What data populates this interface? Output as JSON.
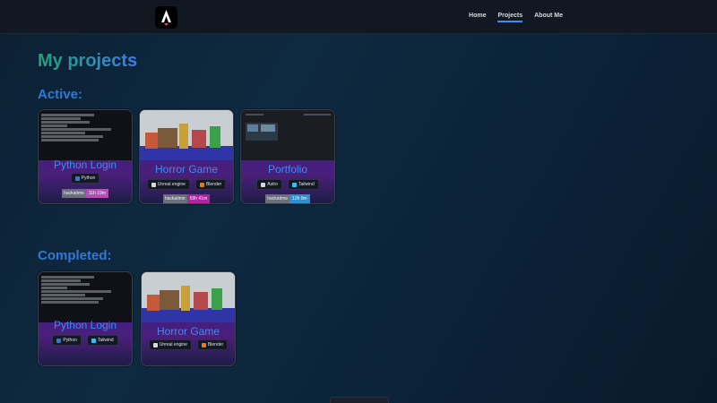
{
  "header": {
    "logo_icon": "astro-logo-icon",
    "nav": [
      {
        "label": "Home",
        "active": false
      },
      {
        "label": "Projects",
        "active": true
      },
      {
        "label": "About Me",
        "active": false
      }
    ]
  },
  "main": {
    "title": "My projects",
    "active_title": "Active:",
    "completed_title": "Completed:",
    "active": [
      {
        "title": "Python Login",
        "badges": [
          {
            "label": "Python",
            "icon": "python-icon"
          }
        ],
        "hackatime": {
          "label": "hackatime",
          "value": "11h 19m",
          "color": "#b24fb7"
        }
      },
      {
        "title": "Horror Game",
        "badges": [
          {
            "label": "Unreal engine",
            "icon": "unreal-engine-icon"
          },
          {
            "label": "Blender",
            "icon": "blender-icon"
          }
        ],
        "hackatime": {
          "label": "hackatime",
          "value": "59h 41m",
          "color": "#b0239f"
        }
      },
      {
        "title": "Portfolio",
        "badges": [
          {
            "label": "Astro",
            "icon": "astro-icon"
          },
          {
            "label": "Tailwind",
            "icon": "tailwind-icon"
          }
        ],
        "hackatime": {
          "label": "hackatime",
          "value": "12h 0m",
          "color": "#2b8fd2"
        }
      }
    ],
    "completed": [
      {
        "title": "Python Login",
        "badges": [
          {
            "label": "Python",
            "icon": "python-icon"
          },
          {
            "label": "Tailwind",
            "icon": "tailwind-icon"
          }
        ]
      },
      {
        "title": "Horror Game",
        "badges": [
          {
            "label": "Unreal engine",
            "icon": "unreal-engine-icon"
          },
          {
            "label": "Blender",
            "icon": "blender-icon"
          }
        ]
      }
    ]
  }
}
